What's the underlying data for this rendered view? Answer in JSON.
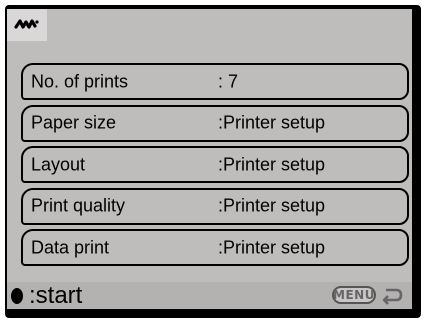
{
  "header": {
    "icon": "print-mode-icon"
  },
  "menu": {
    "items": [
      {
        "label": "No. of prints",
        "value": ":  7"
      },
      {
        "label": "Paper size",
        "value": ":Printer setup"
      },
      {
        "label": "Layout",
        "value": ":Printer setup"
      },
      {
        "label": "Print quality",
        "value": ":Printer setup"
      },
      {
        "label": "Data print",
        "value": ":Printer setup"
      }
    ]
  },
  "footer": {
    "start_label": ":start",
    "menu_key_label": "MENU",
    "back_icon": "return-arrow-icon",
    "start_icon": "center-button-icon"
  },
  "colors": {
    "panel": "#bfbcbc",
    "frame": "#000000",
    "header_tile": "#d9d7d7",
    "footer": "#b4b1b1"
  }
}
